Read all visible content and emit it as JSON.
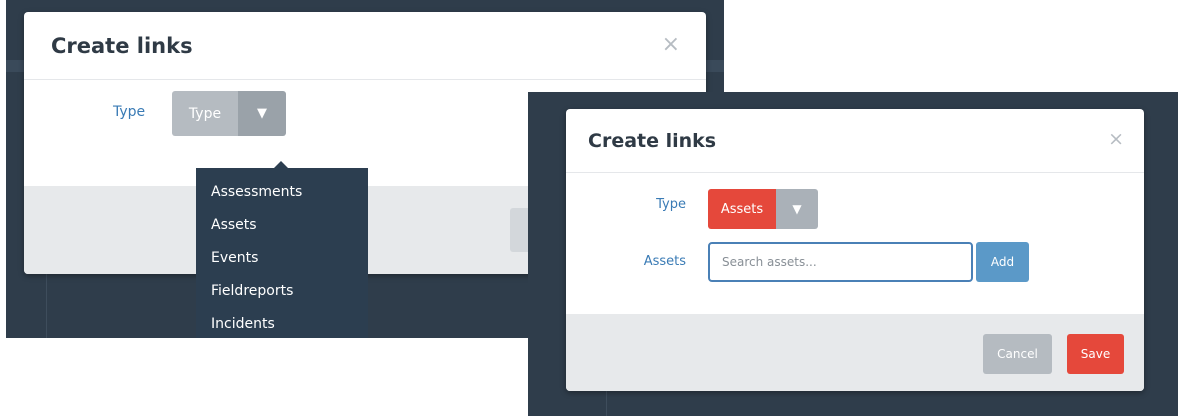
{
  "screen1": {
    "modal": {
      "title": "Create links",
      "close_glyph": "×",
      "type_label": "Type",
      "type_button_label": "Type",
      "caret_glyph": "▼"
    },
    "dropdown": {
      "items": [
        "Assessments",
        "Assets",
        "Events",
        "Fieldreports",
        "Incidents"
      ]
    }
  },
  "screen2": {
    "modal": {
      "title": "Create links",
      "close_glyph": "×",
      "type_label": "Type",
      "type_button_label": "Assets",
      "caret_glyph": "▼",
      "assets_label": "Assets",
      "search_placeholder": "Search assets...",
      "add_label": "Add",
      "cancel_label": "Cancel",
      "save_label": "Save"
    }
  },
  "colors": {
    "background_dark": "#2f3d4b",
    "label_blue": "#3a7bb5",
    "accent_red": "#e5483b",
    "add_blue": "#5b99c8",
    "neutral_gray": "#b5bbc1",
    "dropdown_navy": "#2c3e50"
  }
}
